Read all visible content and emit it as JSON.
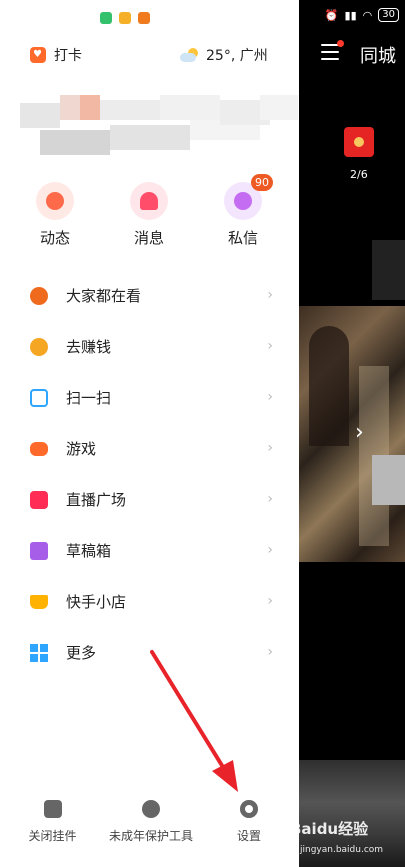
{
  "status_bar": {
    "battery": "30"
  },
  "background": {
    "tab_city": "同城",
    "redpack_count": "2/6"
  },
  "drawer": {
    "checkin_label": "打卡",
    "weather": "25°, 广州",
    "quick_actions": [
      {
        "label": "动态",
        "icon": "planet-icon",
        "color": "#ff6b4a"
      },
      {
        "label": "消息",
        "icon": "bell-icon",
        "color": "#ff4d6a"
      },
      {
        "label": "私信",
        "icon": "chat-icon",
        "color": "#c46cf2",
        "badge": "90"
      }
    ],
    "menu": [
      {
        "label": "大家都在看",
        "icon": "leaf-icon",
        "color": "#f06a1e"
      },
      {
        "label": "去赚钱",
        "icon": "coin-icon",
        "color": "#f5a623"
      },
      {
        "label": "扫一扫",
        "icon": "scan-icon",
        "color": "#2ea6ff"
      },
      {
        "label": "游戏",
        "icon": "gamepad-icon",
        "color": "#ff6a2b"
      },
      {
        "label": "直播广场",
        "icon": "live-icon",
        "color": "#ff2d55"
      },
      {
        "label": "草稿箱",
        "icon": "folder-icon",
        "color": "#a65de8"
      },
      {
        "label": "快手小店",
        "icon": "cart-icon",
        "color": "#ffb300"
      },
      {
        "label": "更多",
        "icon": "grid-icon",
        "color": "#2ea6ff"
      }
    ],
    "bottom": [
      {
        "label": "关闭挂件",
        "icon": "widget-icon"
      },
      {
        "label": "未成年保护工具",
        "icon": "shield-child-icon"
      },
      {
        "label": "设置",
        "icon": "gear-icon"
      }
    ]
  },
  "watermark": {
    "brand": "Baidu经验",
    "url": "jingyan.baidu.com"
  }
}
